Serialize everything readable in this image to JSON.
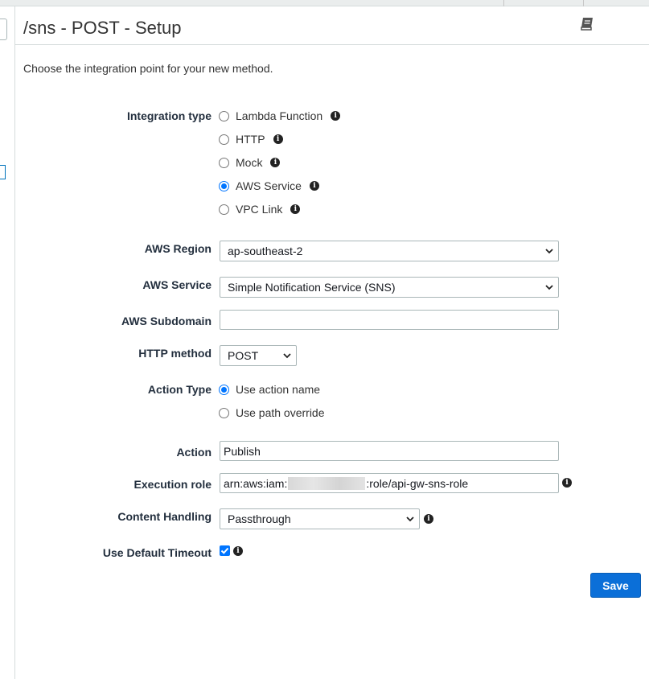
{
  "page": {
    "title": "/sns - POST - Setup",
    "intro": "Choose the integration point for your new method."
  },
  "integration_type": {
    "label": "Integration type",
    "options": [
      "Lambda Function",
      "HTTP",
      "Mock",
      "AWS Service",
      "VPC Link"
    ],
    "selected": "AWS Service"
  },
  "aws_region": {
    "label": "AWS Region",
    "value": "ap-southeast-2"
  },
  "aws_service": {
    "label": "AWS Service",
    "value": "Simple Notification Service (SNS)"
  },
  "aws_subdomain": {
    "label": "AWS Subdomain",
    "value": ""
  },
  "http_method": {
    "label": "HTTP method",
    "value": "POST"
  },
  "action_type": {
    "label": "Action Type",
    "options": [
      "Use action name",
      "Use path override"
    ],
    "selected": "Use action name"
  },
  "action": {
    "label": "Action",
    "value": "Publish"
  },
  "execution_role": {
    "label": "Execution role",
    "prefix": "arn:aws:iam:",
    "suffix": ":role/api-gw-sns-role"
  },
  "content_handling": {
    "label": "Content Handling",
    "value": "Passthrough"
  },
  "default_timeout": {
    "label": "Use Default Timeout",
    "checked": true
  },
  "buttons": {
    "save": "Save"
  },
  "icons": {
    "info": "info-icon",
    "book": "book-icon",
    "checkmark": "checkmark-icon"
  },
  "colors": {
    "primary_button": "#0b6fd8",
    "radio_selected": "#0075ff"
  }
}
